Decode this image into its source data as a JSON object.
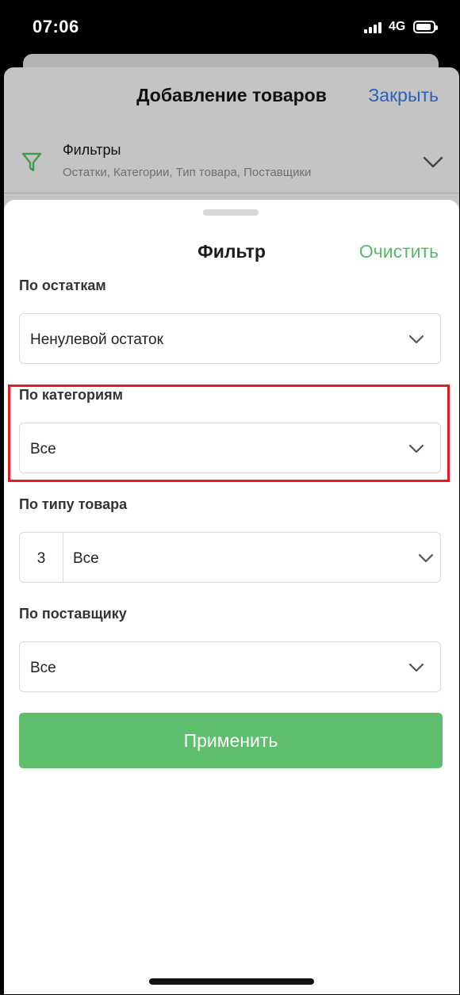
{
  "status_bar": {
    "time": "07:06",
    "network": "4G"
  },
  "background": {
    "title": "Добавление товаров",
    "close_label": "Закрыть",
    "filters": {
      "title": "Фильтры",
      "subtitle": "Остатки, Категории, Тип товара, Поставщики",
      "icon": "filter-icon",
      "accent": "#3f9a4e"
    }
  },
  "sheet": {
    "title": "Фильтр",
    "clear_label": "Очистить",
    "sections": [
      {
        "label": "По остаткам",
        "value": "Ненулевой остаток"
      },
      {
        "label": "По категориям",
        "value": "Все"
      },
      {
        "label": "По типу товара",
        "count": "3",
        "value": "Все"
      },
      {
        "label": "По поставщику",
        "value": "Все"
      }
    ],
    "apply_label": "Применить"
  },
  "colors": {
    "accent_green": "#5fbe6d",
    "link_blue": "#2a5fbe",
    "highlight_red": "#e01b2a"
  }
}
